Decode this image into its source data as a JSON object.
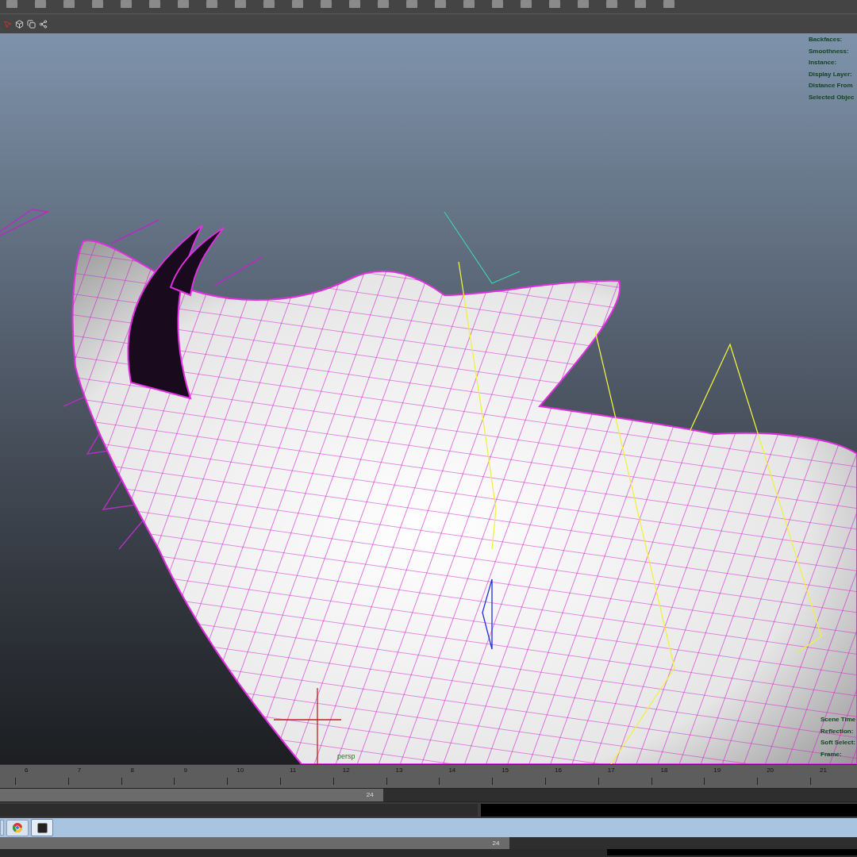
{
  "hud_top": [
    "Backfaces:",
    "Smoothness:",
    "Instance:",
    "Display Layer:",
    "Distance From",
    "Selected Objec"
  ],
  "hud_bottom": [
    "Scene Time",
    "Reflection:",
    "Soft Select:",
    "Frame:"
  ],
  "viewport": {
    "camera_label": "persp"
  },
  "timeline": {
    "frames": [
      "6",
      "7",
      "8",
      "9",
      "10",
      "11",
      "12",
      "13",
      "14",
      "15",
      "16",
      "17",
      "18",
      "19",
      "20",
      "21"
    ]
  },
  "range_bar": {
    "end_label": "24",
    "level": 0.447
  },
  "bottom_range_bar": {
    "end_label": "24",
    "level": 0.594
  }
}
